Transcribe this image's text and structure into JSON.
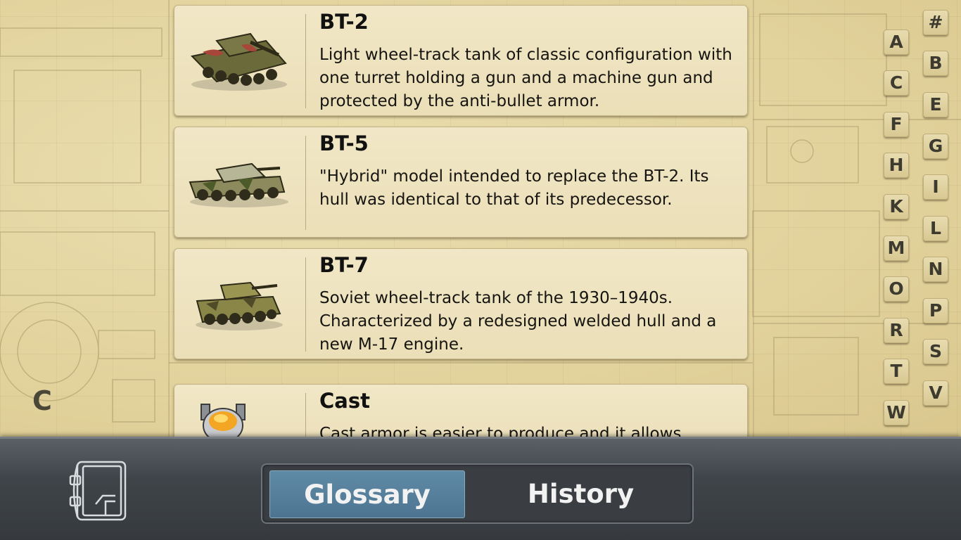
{
  "section_letter": "C",
  "entries": [
    {
      "title": "BT-2",
      "description": "Light wheel-track tank of classic configuration with one turret holding a gun and a machine gun and protected by the anti-bullet armor.",
      "icon": "bt2-tank-icon"
    },
    {
      "title": "BT-5",
      "description": "\"Hybrid\" model intended to replace the BT-2. Its hull was identical to that of its predecessor.",
      "icon": "bt5-tank-icon"
    },
    {
      "title": "BT-7",
      "description": "Soviet wheel-track tank of the 1930–1940s. Characterized by a redesigned welded hull and a new M-17 engine.",
      "icon": "bt7-tank-icon"
    },
    {
      "title": "Cast",
      "description": "Cast armor is easier to produce and it allows",
      "icon": "cast-crucible-icon"
    }
  ],
  "alphabet_index": {
    "left_column": [
      "A",
      "C",
      "F",
      "H",
      "K",
      "M",
      "O",
      "R",
      "T",
      "W"
    ],
    "right_column": [
      "#",
      "B",
      "E",
      "G",
      "I",
      "L",
      "N",
      "P",
      "S",
      "V"
    ]
  },
  "bottom_bar": {
    "book_icon": "encyclopedia-book-icon",
    "tabs": [
      {
        "label": "Glossary",
        "active": true
      },
      {
        "label": "History",
        "active": false
      }
    ]
  },
  "colors": {
    "background": "#e6d8a4",
    "card": "#efe4c1",
    "active_tab": "#5a85a1",
    "bottom_bar": "#3f4449"
  }
}
